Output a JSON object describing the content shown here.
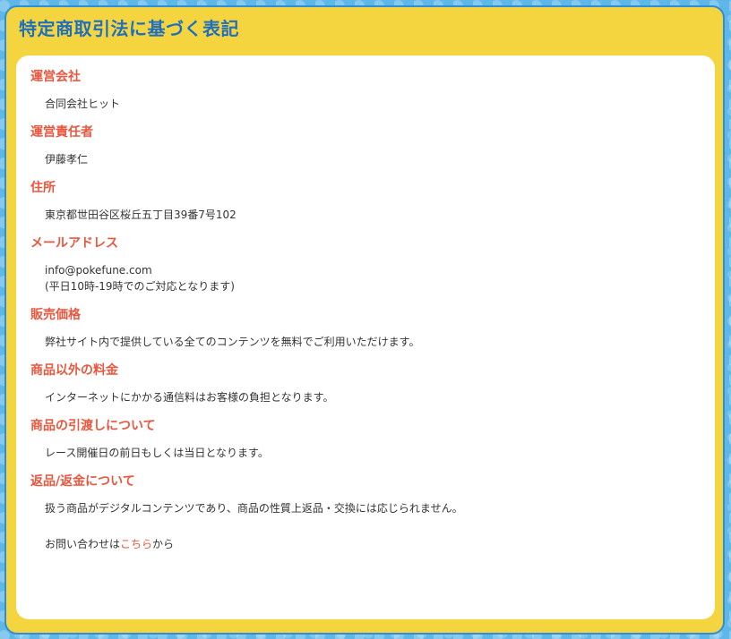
{
  "page_title": "特定商取引法に基づく表記",
  "sections": [
    {
      "heading": "運営会社",
      "lines": [
        "合同会社ヒット"
      ]
    },
    {
      "heading": "運営責任者",
      "lines": [
        "伊藤孝仁"
      ]
    },
    {
      "heading": "住所",
      "lines": [
        "東京都世田谷区桜丘五丁目39番7号102"
      ]
    },
    {
      "heading": "メールアドレス",
      "lines": [
        "info@pokefune.com",
        "(平日10時-19時でのご対応となります)"
      ]
    },
    {
      "heading": "販売価格",
      "lines": [
        "弊社サイト内で提供している全てのコンテンツを無料でご利用いただけます。"
      ]
    },
    {
      "heading": "商品以外の料金",
      "lines": [
        "インターネットにかかる通信料はお客様の負担となります。"
      ]
    },
    {
      "heading": "商品の引渡しについて",
      "lines": [
        "レース開催日の前日もしくは当日となります。"
      ]
    },
    {
      "heading": "返品/返金について",
      "lines": [
        "扱う商品がデジタルコンテンツであり、商品の性質上返品・交換には応じられません。"
      ]
    }
  ],
  "contact": {
    "prefix": "お問い合わせは",
    "link_label": "こちら",
    "suffix": "から"
  },
  "colors": {
    "frame_border": "#2d8fd6",
    "frame_fill": "#f5d53f",
    "title": "#1f6fbf",
    "heading": "#e9573f",
    "body_text": "#333333"
  }
}
